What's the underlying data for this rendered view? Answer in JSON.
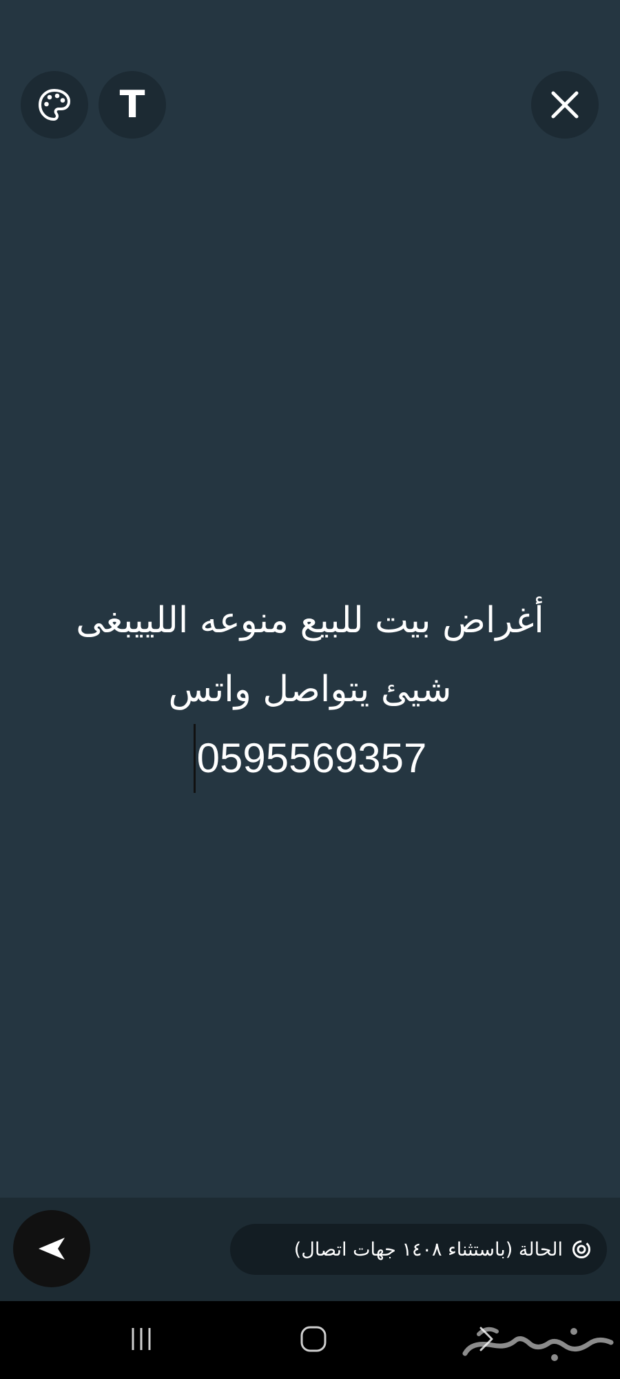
{
  "editor": {
    "text_tool_label": "T",
    "status_lines": [
      "أغراض بيت للبيع منوعه اللييبغى",
      "شيئ يتواصل واتس",
      "0595569357"
    ]
  },
  "footer": {
    "audience_label": "الحالة (باستثناء ١٤٠٨ جهات اتصال)"
  },
  "icons": {
    "palette": "palette-icon",
    "text": "text-style-icon",
    "close": "close-icon",
    "send": "send-icon",
    "audience": "status-icon",
    "recents": "recents-icon",
    "home": "home-icon",
    "back": "back-icon"
  },
  "colors": {
    "background": "#253641",
    "bottom_bar": "#1d2b33",
    "button": "#1c2a33",
    "text": "#ffffff"
  }
}
